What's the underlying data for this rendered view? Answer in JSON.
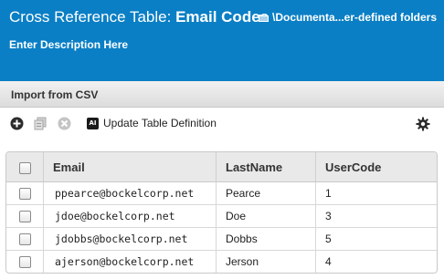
{
  "header": {
    "title_prefix": "Cross Reference Table:",
    "title_name": "Email Codes",
    "folder_path": "\\Documenta...er-defined folders",
    "description": "Enter Description Here"
  },
  "import": {
    "label": "Import from CSV"
  },
  "toolbar": {
    "update_definition_label": "Update Table Definition",
    "ai_badge": "AI"
  },
  "table": {
    "columns": [
      "Email",
      "LastName",
      "UserCode"
    ],
    "rows": [
      {
        "email": "ppearce@bockelcorp.net",
        "lastname": "Pearce",
        "usercode": "1"
      },
      {
        "email": "jdoe@bockelcorp.net",
        "lastname": "Doe",
        "usercode": "3"
      },
      {
        "email": "jdobbs@bockelcorp.net",
        "lastname": "Dobbs",
        "usercode": "5"
      },
      {
        "email": "ajerson@bockelcorp.net",
        "lastname": "Jerson",
        "usercode": "4"
      }
    ]
  },
  "colors": {
    "header_bg": "#0a7fc5"
  }
}
